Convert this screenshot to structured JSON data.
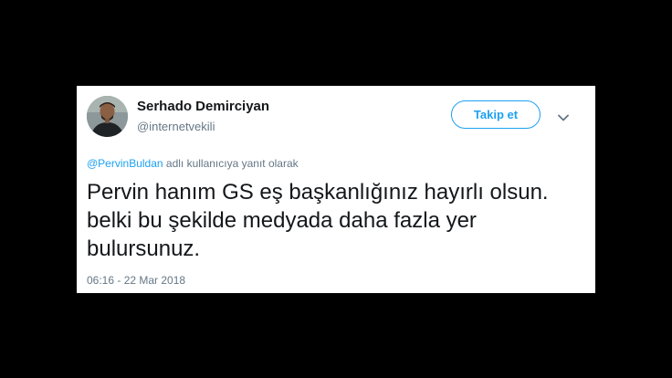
{
  "tweet": {
    "author": {
      "name": "Serhado Demirciyan",
      "handle": "@internetvekili"
    },
    "follow_label": "Takip et",
    "reply_context": {
      "mention": "@PervinBuldan",
      "suffix": " adlı kullanıcıya yanıt olarak"
    },
    "text_lines": [
      "Pervin hanım GS eş başkanlığınız hayırlı olsun.",
      "belki bu şekilde medyada daha fazla yer",
      "bulursunuz."
    ],
    "timestamp": "06:16 - 22 Mar 2018"
  },
  "icons": {
    "menu": "chevron-down-icon",
    "avatar": "profile-photo"
  },
  "colors": {
    "background": "#000000",
    "card": "#ffffff",
    "accent": "#1da1f2",
    "text_primary": "#14171a",
    "text_secondary": "#657786"
  }
}
